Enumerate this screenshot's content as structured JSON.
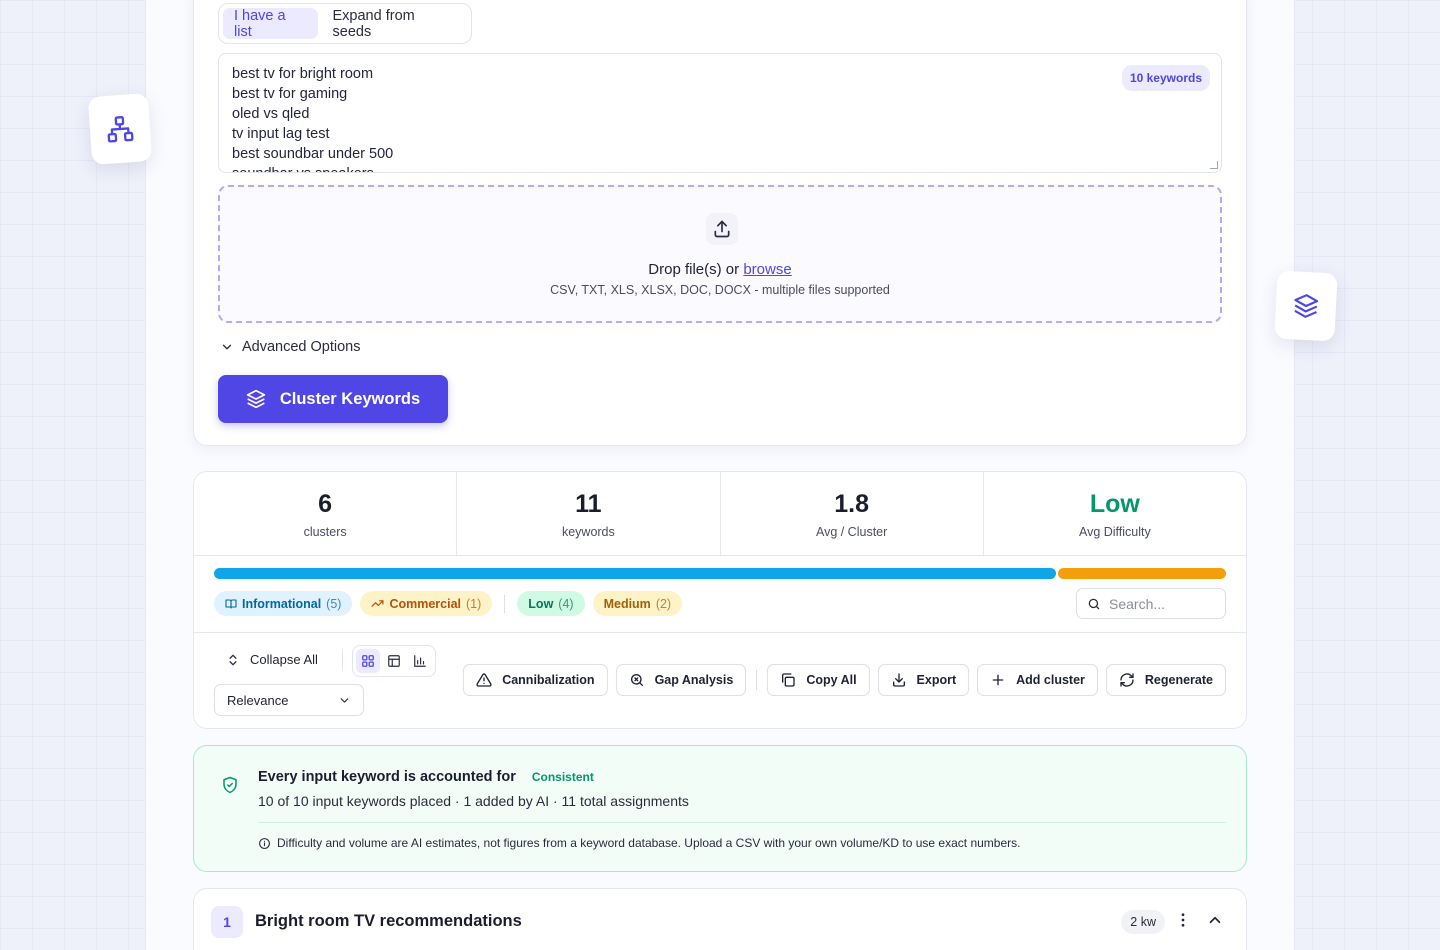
{
  "colors": {
    "accent": "#4f46e5",
    "informational": "#0ea5e9",
    "commercial": "#f59e0b",
    "success": "#059669"
  },
  "input": {
    "tabs": [
      {
        "label": "I have a list",
        "active": true
      },
      {
        "label": "Expand from seeds",
        "active": false
      }
    ],
    "keyword_badge": "10 keywords",
    "keywords": [
      "best tv for bright room",
      "best tv for gaming",
      "oled vs qled",
      "tv input lag test",
      "best soundbar under 500",
      "soundbar vs speakers"
    ],
    "drop": {
      "icon": "upload-icon",
      "title_prefix": "Drop file(s) or ",
      "browse_label": "browse",
      "subtitle": "CSV, TXT, XLS, XLSX, DOC, DOCX - multiple files supported"
    },
    "advanced_label": "Advanced Options",
    "cluster_button": "Cluster Keywords"
  },
  "stats": [
    {
      "value": "6",
      "label": "clusters"
    },
    {
      "value": "11",
      "label": "keywords"
    },
    {
      "value": "1.8",
      "label": "Avg / Cluster"
    },
    {
      "value": "Low",
      "label": "Avg Difficulty"
    }
  ],
  "intent_bar": [
    {
      "name": "Informational",
      "share": 5
    },
    {
      "name": "Commercial",
      "share": 1
    }
  ],
  "filters": {
    "chips": [
      {
        "label": "Informational",
        "count": "(5)"
      },
      {
        "label": "Commercial",
        "count": "(1)"
      },
      {
        "label": "Low",
        "count": "(4)"
      },
      {
        "label": "Medium",
        "count": "(2)"
      }
    ],
    "search_placeholder": "Search..."
  },
  "toolbar": {
    "collapse_label": "Collapse All",
    "sort_value": "Relevance",
    "actions": [
      {
        "label": "Cannibalization",
        "icon": "warning-icon"
      },
      {
        "label": "Gap Analysis",
        "icon": "search-x-icon"
      },
      {
        "label": "Copy All",
        "icon": "copy-icon"
      },
      {
        "label": "Export",
        "icon": "download-icon"
      },
      {
        "label": "Add cluster",
        "icon": "plus-icon"
      },
      {
        "label": "Regenerate",
        "icon": "refresh-icon"
      }
    ]
  },
  "coverage": {
    "title": "Every input keyword is accounted for",
    "tag": "Consistent",
    "summary": "10 of 10 input keywords placed · 1 added by AI · 11 total assignments",
    "note": "Difficulty and volume are AI estimates, not figures from a keyword database. Upload a CSV with your own volume/KD to use exact numbers."
  },
  "clusters": [
    {
      "number": "1",
      "title": "Bright room TV recommendations",
      "count": "2 kw"
    }
  ]
}
